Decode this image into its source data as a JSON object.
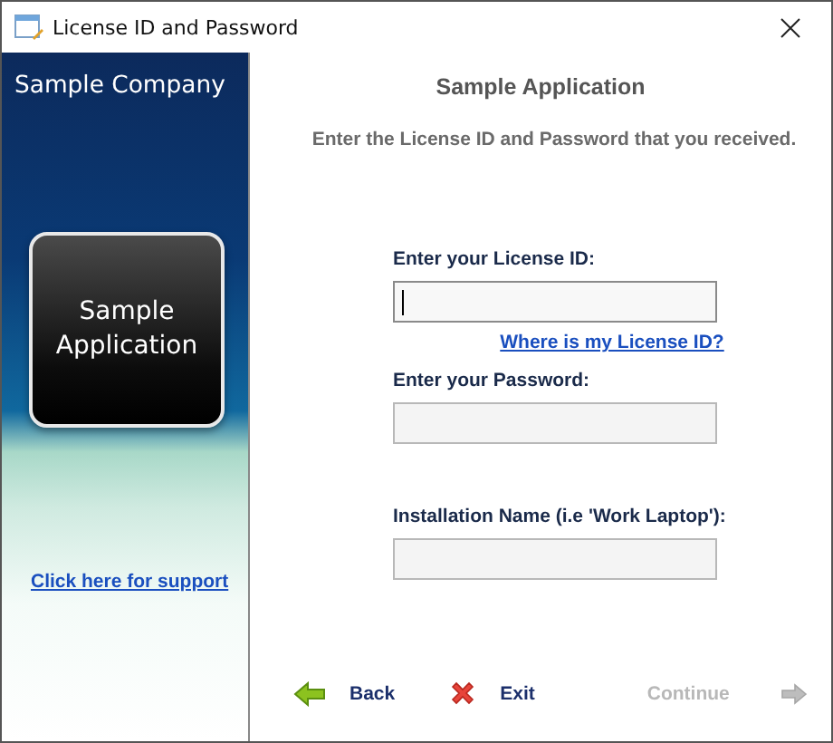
{
  "window": {
    "title": "License ID and Password"
  },
  "sidebar": {
    "company": "Sample Company",
    "product_tile": "Sample Application",
    "support_link": "Click here for support"
  },
  "header": {
    "title": "Sample Application",
    "instruction": "Enter the License ID and Password that you received."
  },
  "fields": [
    {
      "label": "Enter your License ID:",
      "focused": true,
      "help_link": "Where is my License ID?"
    },
    {
      "label": "Enter your Password:",
      "focused": false
    },
    {
      "label": "Installation Name (i.e 'Work Laptop'):",
      "focused": false
    }
  ],
  "buttons": [
    {
      "kind": "back",
      "label": "Back",
      "disabled": false
    },
    {
      "kind": "exit",
      "label": "Exit",
      "disabled": false
    },
    {
      "kind": "continue",
      "label": "Continue",
      "disabled": true
    }
  ]
}
